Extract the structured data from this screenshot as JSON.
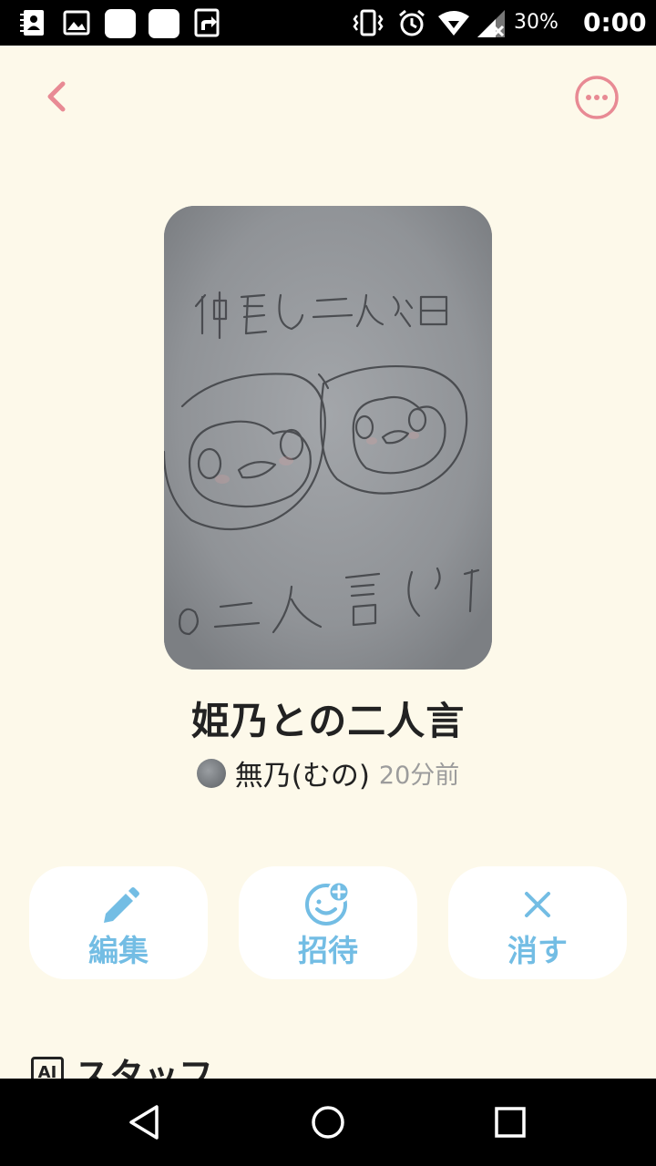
{
  "status_bar": {
    "battery_percent": "30%",
    "time": "0:00"
  },
  "header": {
    "back_icon": "chevron-left-icon",
    "more_icon": "more-horizontal-icon"
  },
  "book": {
    "title": "姫乃との二人言",
    "author": {
      "name": "無乃(むの)",
      "time_ago": "20分前"
    }
  },
  "actions": [
    {
      "label": "編集",
      "icon": "pencil-icon"
    },
    {
      "label": "招待",
      "icon": "add-person-icon"
    },
    {
      "label": "消す",
      "icon": "close-icon"
    }
  ],
  "staff_section": {
    "title": "スタッフ",
    "badge": "AI"
  },
  "colors": {
    "background": "#fdf9ea",
    "accent_pink": "#e88a94",
    "action_blue": "#73bde4",
    "text": "#222222",
    "muted_text": "#9c9c9c"
  }
}
